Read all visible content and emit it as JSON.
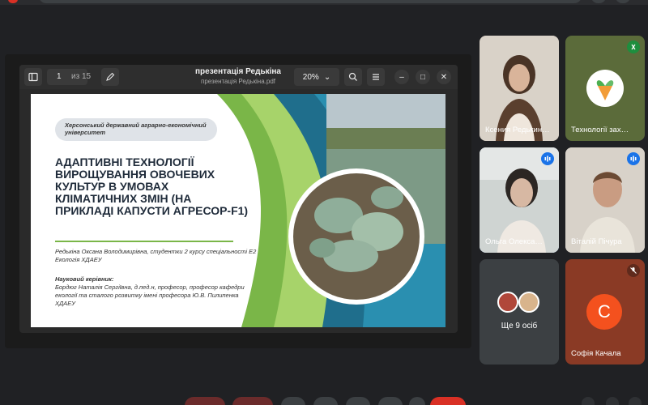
{
  "presentation": {
    "title": "презентація Редькіна",
    "filename": "презентація Редькіна.pdf",
    "page_current": "1",
    "page_total": "из 15",
    "zoom": "20%"
  },
  "slide": {
    "university": "Херсонський державний аграрно-економічний університет",
    "title": "АДАПТИВНІ ТЕХНОЛОГІЇ ВИРОЩУВАННЯ ОВОЧЕВИХ КУЛЬТУР В УМОВАХ КЛІМАТИЧНИХ ЗМІН (НА ПРИКЛАДІ КАПУСТИ АГРЕСОР-F1)",
    "author": "Редькіна Оксана Володимирівна, студентки 2 курсу спеціальності Е2 Екологія ХДАЕУ",
    "advisor_heading": "Науковий керівник:",
    "advisor_text": "Бордюг Наталія Сергіївна, д.пед.н, професор, професор кафедри екології та сталого розвитку імені професора Ю.В. Пилипенка ХДАЕУ"
  },
  "participants": [
    {
      "name": "Ксения Редькин…"
    },
    {
      "name": "Технології зах…"
    },
    {
      "name": "Ольга Олекса…"
    },
    {
      "name": "Віталій Пічура"
    },
    {
      "name": "Ще 9 осіб"
    },
    {
      "name": "Софія Качала",
      "initial": "С"
    }
  ],
  "colors": {
    "accent_blue": "#8ab4f8",
    "avatar_orange": "#f4511e",
    "muted_red": "#d93025",
    "slide_green": "#7ab648",
    "slide_teal": "#1f6e8c"
  }
}
